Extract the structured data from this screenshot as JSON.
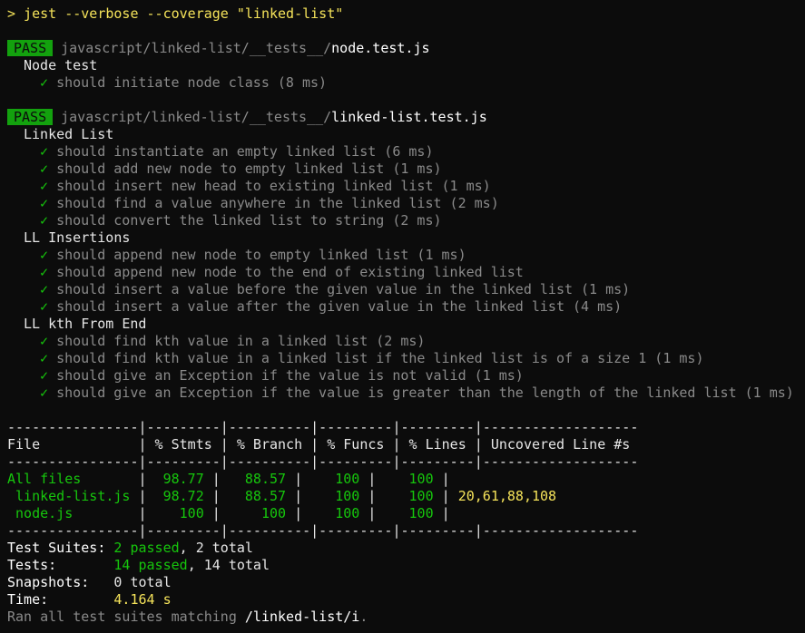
{
  "command": "> jest --verbose --coverage \"linked-list\"",
  "suites": [
    {
      "badge": "PASS",
      "path_dir": "javascript/linked-list/__tests__/",
      "path_file": "node.test.js",
      "groups": [
        {
          "title": "Node test",
          "tests": [
            "should initiate node class (8 ms)"
          ]
        }
      ]
    },
    {
      "badge": "PASS",
      "path_dir": "javascript/linked-list/__tests__/",
      "path_file": "linked-list.test.js",
      "groups": [
        {
          "title": "Linked List",
          "tests": [
            "should instantiate an empty linked list (6 ms)",
            "should add new node to empty linked list (1 ms)",
            "should insert new head to existing linked list (1 ms)",
            "should find a value anywhere in the linked list (2 ms)",
            "should convert the linked list to string (2 ms)"
          ]
        },
        {
          "title": "LL Insertions",
          "tests": [
            "should append new node to empty linked list (1 ms)",
            "should append new node to the end of existing linked list",
            "should insert a value before the given value in the linked list (1 ms)",
            "should insert a value after the given value in the linked list (4 ms)"
          ]
        },
        {
          "title": "LL kth From End",
          "tests": [
            "should find kth value in a linked list (2 ms)",
            "should find kth value in a linked list if the linked list is of a size 1 (1 ms)",
            "should give an Exception if the value is not valid (1 ms)",
            "should give an Exception if the value is greater than the length of the linked list (1 ms)"
          ]
        }
      ]
    }
  ],
  "check_glyph": "✓",
  "coverage": {
    "separator": "----------------|---------|----------|---------|---------|-------------------",
    "header": "File            | % Stmts | % Branch | % Funcs | % Lines | Uncovered Line #s ",
    "rows": [
      {
        "file": "All files       ",
        "stmts": "  98.77 ",
        "branch": "   88.57 ",
        "funcs": "    100 ",
        "lines": "    100 ",
        "uncovered": ""
      },
      {
        "file": " linked-list.js ",
        "stmts": "  98.72 ",
        "branch": "   88.57 ",
        "funcs": "    100 ",
        "lines": "    100 ",
        "uncovered": " 20,61,88,108"
      },
      {
        "file": " node.js        ",
        "stmts": "    100 ",
        "branch": "     100 ",
        "funcs": "    100 ",
        "lines": "    100 ",
        "uncovered": ""
      }
    ]
  },
  "summary": {
    "suites_label": "Test Suites: ",
    "suites_passed": "2 passed",
    "suites_total": ", 2 total",
    "tests_label": "Tests:       ",
    "tests_passed": "14 passed",
    "tests_total": ", 14 total",
    "snapshots_label": "Snapshots:   ",
    "snapshots_value": "0 total",
    "time_label": "Time:        ",
    "time_value": "4.164 s",
    "ran_text": "Ran all test suites matching ",
    "ran_pattern": "/linked-list/i",
    "ran_end": "."
  },
  "colors": {
    "background": "#0c0c0c",
    "pass_badge": "#13a10e",
    "green": "#16c60c",
    "yellow": "#f5e35a",
    "gray": "#8a8a8a"
  }
}
